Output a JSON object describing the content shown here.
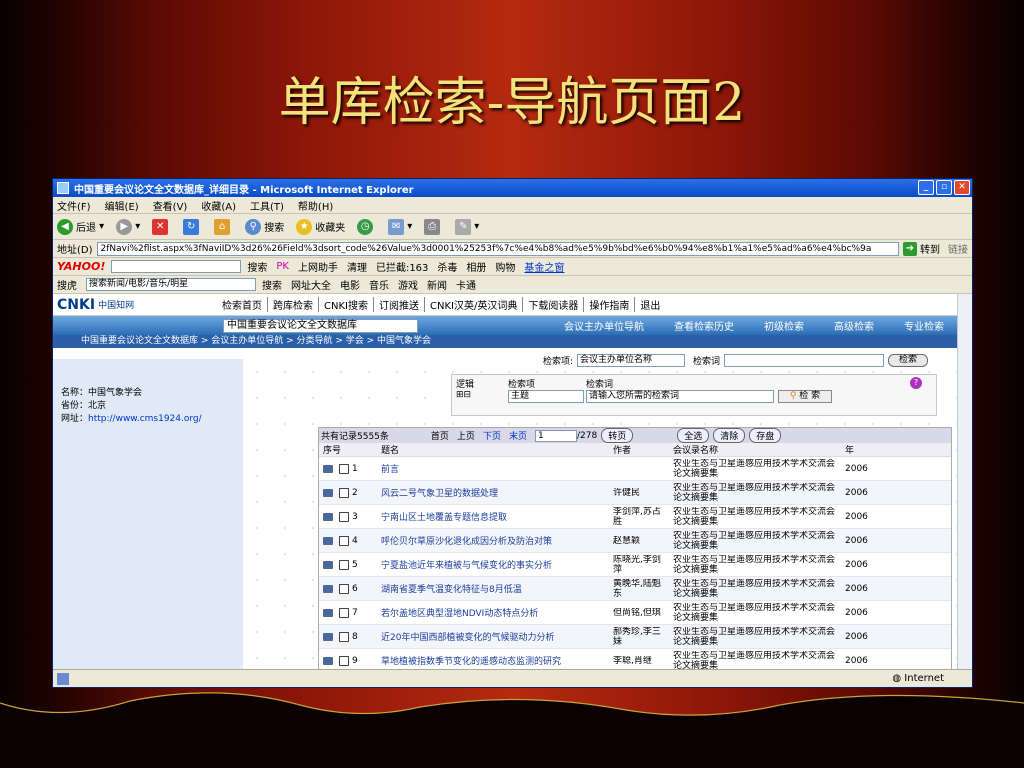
{
  "slide": {
    "title": "单库检索-导航页面2"
  },
  "window": {
    "title": "中国重要会议论文全文数据库_详细目录 - Microsoft Internet Explorer"
  },
  "menu": [
    "文件(F)",
    "编辑(E)",
    "查看(V)",
    "收藏(A)",
    "工具(T)",
    "帮助(H)"
  ],
  "toolbar": {
    "back": "后退",
    "search": "搜索",
    "favorites": "收藏夹"
  },
  "address": {
    "label": "地址(D)",
    "value": "2fNavi%2flist.aspx%3fNaviID%3d26%26Field%3dsort_code%26Value%3d0001%25253f%7c%e4%b8%ad%e5%9b%bd%e6%b0%94%e8%b1%a1%e5%ad%a6%e4%bc%9a",
    "go": "转到",
    "links": "链接"
  },
  "yahoo": {
    "logo": "YAHOO!",
    "items": [
      "搜索",
      "PK",
      "上网助手",
      "清理",
      "已拦截:163",
      "杀毒",
      "相册",
      "购物",
      "基金之窗"
    ]
  },
  "linkbar": {
    "label": "搜虎",
    "select": "搜索新闻/电影/音乐/明星",
    "items": [
      "搜索",
      "网址大全",
      "电影",
      "音乐",
      "游戏",
      "新闻",
      "卡通"
    ]
  },
  "cnki": {
    "logo": "CNKI",
    "logo_sub": "中国知网",
    "site": "www.cnki.net",
    "nav": [
      "检索首页",
      "跨库检索",
      "CNKI搜索",
      "订阅推送",
      "CNKI汉英/英汉词典",
      "下载阅读器",
      "操作指南",
      "退出"
    ],
    "db_select": "中国重要会议论文全文数据库",
    "subnav": [
      "会议主办单位导航",
      "查看检索历史",
      "初级检索",
      "高级检索",
      "专业检索"
    ],
    "breadcrumb": "中国重要会议论文全文数据库 > 会议主办单位导航 > 分类导航 > 学会 > 中国气象学会"
  },
  "org": {
    "name": "名称：中国气象学会",
    "province": "省份：北京",
    "url_label": "网址：",
    "url": "http://www.cms1924.org/"
  },
  "search": {
    "field_label": "检索项:",
    "field_value": "会议主办单位名称",
    "term_label": "检索词",
    "button": "检索",
    "logic_label": "逻辑",
    "item_label": "检索项",
    "term_label2": "检索词",
    "adv_field": "主题",
    "placeholder": "请输入您所需的检索词",
    "adv_button": "检 索"
  },
  "results": {
    "total": "共有记录5555条",
    "first": "首页",
    "prev": "上页",
    "next": "下页",
    "last": "末页",
    "page": "1",
    "pages": "/278",
    "go": "转页",
    "select_all": "全选",
    "clear": "清除",
    "save": "存盘",
    "columns": [
      "序号",
      "题名",
      "作者",
      "会议录名称",
      "年"
    ],
    "rows": [
      {
        "no": "1",
        "title": "前言",
        "author": "",
        "conf": "农业生态与卫星遥感应用技术学术交流会论文摘要集",
        "year": "2006"
      },
      {
        "no": "2",
        "title": "风云二号气象卫星的数据处理",
        "author": "许健民",
        "conf": "农业生态与卫星遥感应用技术学术交流会论文摘要集",
        "year": "2006"
      },
      {
        "no": "3",
        "title": "宁南山区土地覆盖专题信息提取",
        "author": "李剑萍,苏占胜",
        "conf": "农业生态与卫星遥感应用技术学术交流会论文摘要集",
        "year": "2006"
      },
      {
        "no": "4",
        "title": "呼伦贝尔草原沙化退化成因分析及防治对策",
        "author": "赵慧颖",
        "conf": "农业生态与卫星遥感应用技术学术交流会论文摘要集",
        "year": "2006"
      },
      {
        "no": "5",
        "title": "宁夏盐池近年来植被与气候变化的事实分析",
        "author": "陈晓光,李剑萍",
        "conf": "农业生态与卫星遥感应用技术学术交流会论文摘要集",
        "year": "2006"
      },
      {
        "no": "6",
        "title": "湖南省夏季气温变化特征与8月低温",
        "author": "黄晚华,陆魁东",
        "conf": "农业生态与卫星遥感应用技术学术交流会论文摘要集",
        "year": "2006"
      },
      {
        "no": "7",
        "title": "若尔盖地区典型湿地NDVI动态特点分析",
        "author": "但尚铭,但琪",
        "conf": "农业生态与卫星遥感应用技术学术交流会论文摘要集",
        "year": "2006"
      },
      {
        "no": "8",
        "title": "近20年中国西部植被变化的气候驱动力分析",
        "author": "郝秀珍,李三妹",
        "conf": "农业生态与卫星遥感应用技术学术交流会论文摘要集",
        "year": "2006"
      },
      {
        "no": "9",
        "title": "草地植被指数季节变化的遥感动态监测的研究",
        "author": "李聪,肖继",
        "conf": "农业生态与卫星遥感应用技术学术交流会论文摘要集",
        "year": "2006"
      }
    ]
  },
  "status": {
    "zone": "Internet"
  },
  "colors": {
    "title": "#f3e27a",
    "ie_titlebar": "#0a4cc8",
    "cnki_blue": "#2b6db4"
  }
}
